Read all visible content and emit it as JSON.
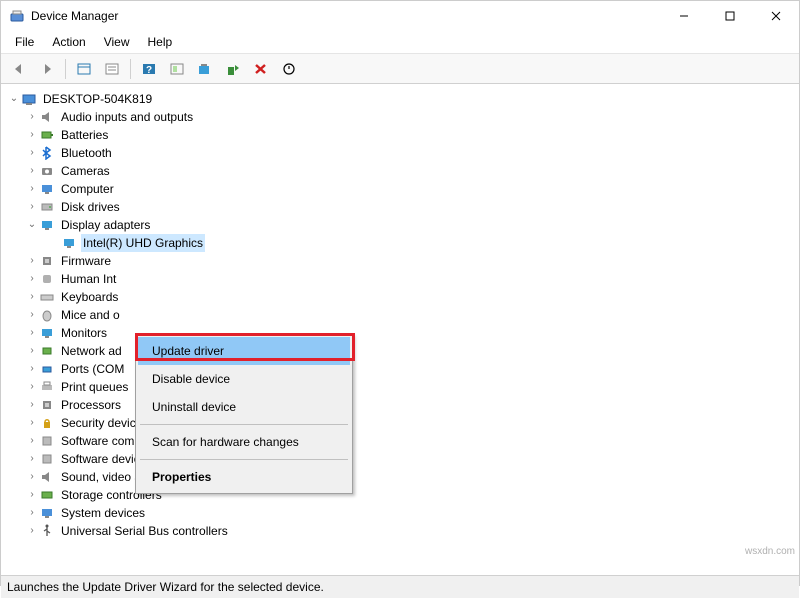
{
  "window": {
    "title": "Device Manager"
  },
  "menubar": {
    "file": "File",
    "action": "Action",
    "view": "View",
    "help": "Help"
  },
  "tree": {
    "root": "DESKTOP-504K819",
    "nodes": {
      "audio": "Audio inputs and outputs",
      "batteries": "Batteries",
      "bluetooth": "Bluetooth",
      "cameras": "Cameras",
      "computer": "Computer",
      "disk": "Disk drives",
      "display": "Display adapters",
      "display_child": "Intel(R) UHD Graphics",
      "firmware": "Firmware",
      "hid": "Human Int",
      "keyboards": "Keyboards",
      "mice": "Mice and o",
      "monitors": "Monitors",
      "network": "Network ad",
      "ports": "Ports (COM",
      "printq": "Print queues",
      "processors": "Processors",
      "security": "Security devices",
      "swcomp": "Software components",
      "swdev": "Software devices",
      "sound": "Sound, video and game controllers",
      "storage": "Storage controllers",
      "sysdev": "System devices",
      "usb": "Universal Serial Bus controllers"
    }
  },
  "context_menu": {
    "update": "Update driver",
    "disable": "Disable device",
    "uninstall": "Uninstall device",
    "scan": "Scan for hardware changes",
    "properties": "Properties"
  },
  "statusbar": {
    "text": "Launches the Update Driver Wizard for the selected device."
  },
  "watermark": "wsxdn.com"
}
